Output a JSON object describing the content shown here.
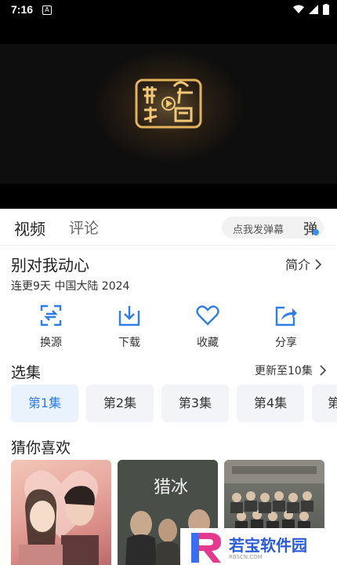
{
  "status": {
    "time": "7:16"
  },
  "tabs": {
    "video": "视频",
    "comments": "评论"
  },
  "danmu": {
    "placeholder": "点我发弹幕",
    "button": "弹"
  },
  "show": {
    "title": "别对我动心",
    "intro_label": "简介",
    "meta": "连更9天 中国大陆 2024"
  },
  "actions": [
    {
      "label": "换源",
      "icon": "switch-source-icon"
    },
    {
      "label": "下载",
      "icon": "download-icon"
    },
    {
      "label": "收藏",
      "icon": "heart-icon"
    },
    {
      "label": "分享",
      "icon": "share-icon"
    }
  ],
  "episodes": {
    "title": "选集",
    "update": "更新至10集",
    "items": [
      "第1集",
      "第2集",
      "第3集",
      "第4集",
      "第"
    ]
  },
  "recommend": {
    "title": "猜你喜欢"
  },
  "thumb2_text": "猎冰",
  "watermark": {
    "text": "若宝软件园",
    "sub": "RBSCN.COM"
  },
  "colors": {
    "accent": "#2f7de8",
    "icon_blue": "#2f7de8"
  }
}
